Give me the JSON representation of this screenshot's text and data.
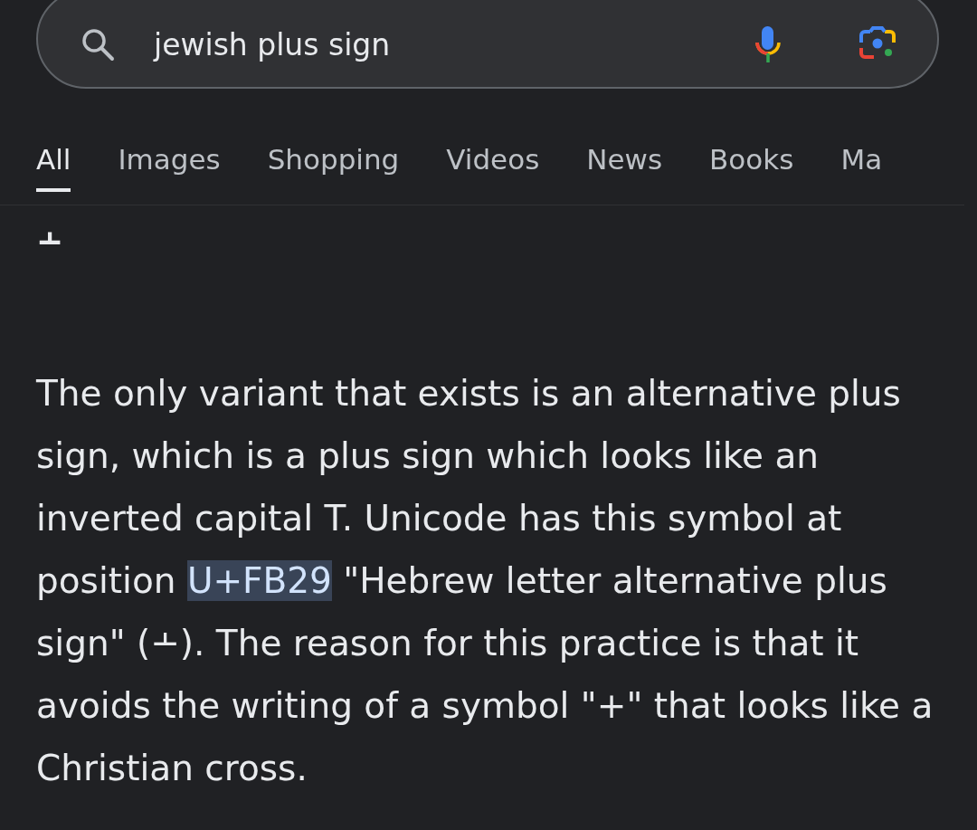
{
  "search": {
    "query": "jewish plus sign"
  },
  "tabs": [
    {
      "label": "All",
      "selected": true
    },
    {
      "label": "Images",
      "selected": false
    },
    {
      "label": "Shopping",
      "selected": false
    },
    {
      "label": "Videos",
      "selected": false
    },
    {
      "label": "News",
      "selected": false
    },
    {
      "label": "Books",
      "selected": false
    },
    {
      "label": "Ma",
      "selected": false
    }
  ],
  "symbol": "﬩",
  "answer": {
    "before": "The only variant that exists is an alternative plus sign, which is a plus sign which looks like an inverted capital T. Unicode has this symbol at position ",
    "highlight": "U+FB29",
    "after": " \"Hebrew letter alternative plus sign\" (﬩). The reason for this practice is that it avoids the writing of a symbol \"+\" that looks like a Christian cross."
  }
}
